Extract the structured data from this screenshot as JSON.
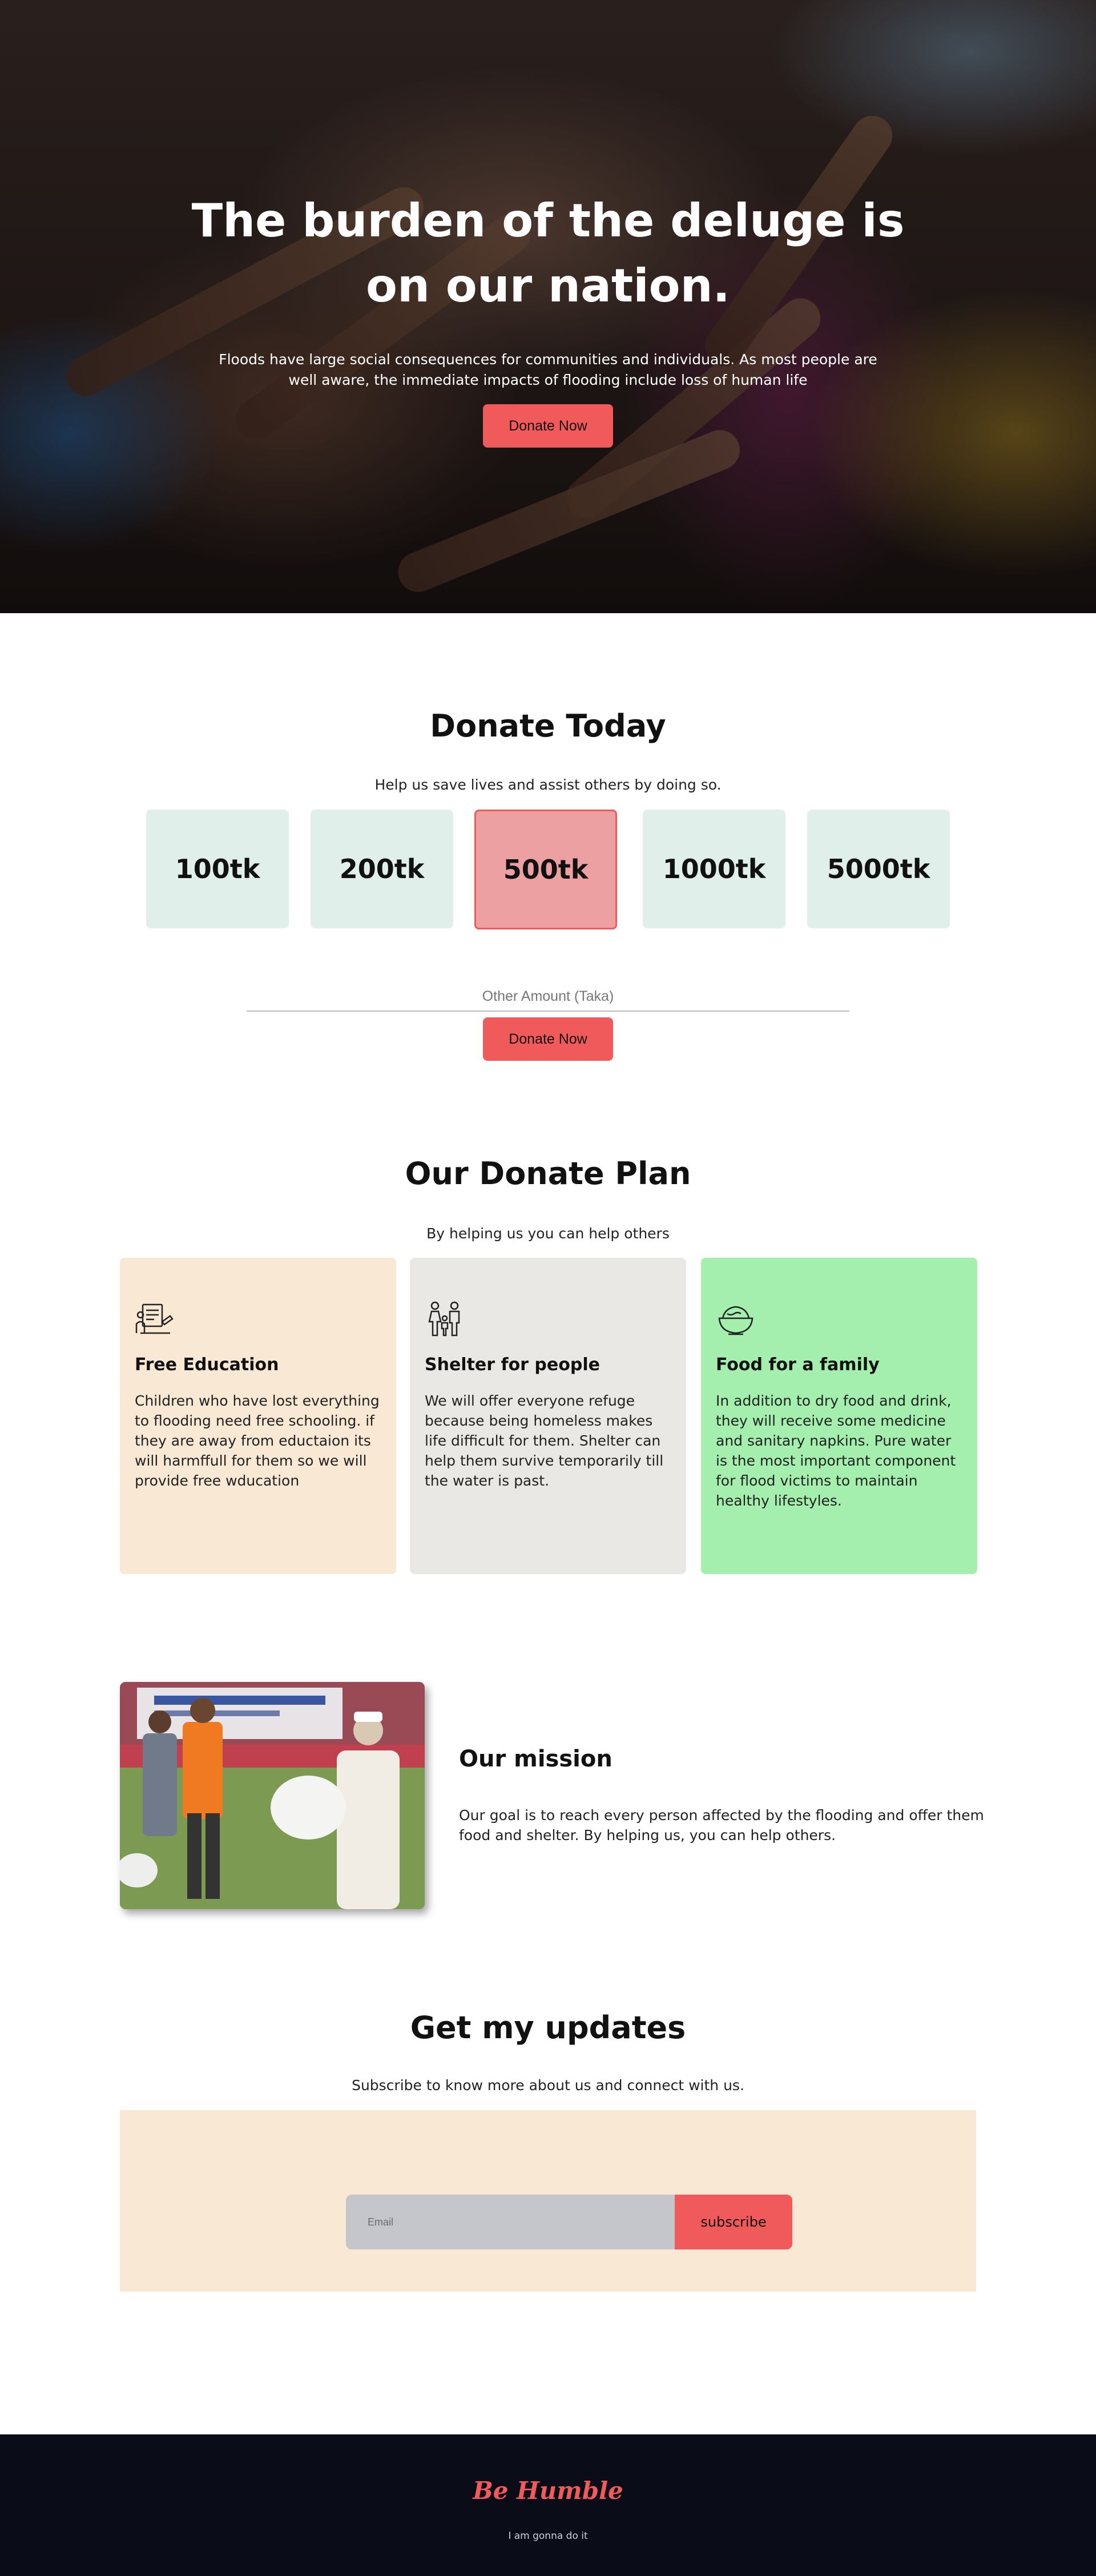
{
  "hero": {
    "title": "The burden of the deluge is on our nation.",
    "subtitle": "Floods have large social consequences for communities and individuals. As most people are well aware, the immediate impacts of flooding include loss of human life",
    "button_label": "Donate Now"
  },
  "donate": {
    "title": "Donate Today",
    "lead": "Help us save lives and assist others by doing so.",
    "amounts": [
      "100tk",
      "200tk",
      "500tk",
      "1000tk",
      "5000tk"
    ],
    "selected_amount": "500tk",
    "other_placeholder": "Other Amount (Taka)",
    "button_label": "Donate Now"
  },
  "plan": {
    "title": "Our Donate Plan",
    "lead": "By helping us you can help others",
    "cards": [
      {
        "icon": "education-icon",
        "title": "Free Education",
        "text": "Children who have lost everything to flooding need free schooling. if they are away from eductaion its will harmffull for them so we will provide free wducation",
        "color": "#f9e8d4"
      },
      {
        "icon": "family-icon",
        "title": "Shelter for people",
        "text": "We will offer everyone refuge because being homeless makes life difficult for them. Shelter can help them survive temporarily till the water is past.",
        "color": "#eae8e5"
      },
      {
        "icon": "food-bowl-icon",
        "title": "Food for a family",
        "text": "In addition to dry food and drink, they will receive some medicine and sanitary napkins. Pure water is the most important component for flood victims to maintain healthy lifestyles.",
        "color": "#a4efad"
      }
    ]
  },
  "mission": {
    "title": "Our mission",
    "text": "Our goal is to reach every person affected by the flooding and offer them food and shelter. By helping us, you can help others."
  },
  "updates": {
    "title": "Get my updates",
    "lead": "Subscribe to know more about us and connect with us.",
    "email_placeholder": "Email",
    "subscribe_label": "subscribe"
  },
  "footer": {
    "brand": "Be Humble",
    "tagline": "I am gonna do it"
  },
  "colors": {
    "accent": "#f15a5a",
    "amount_bg": "#e1efea",
    "footer_bg": "#0a0d18"
  }
}
